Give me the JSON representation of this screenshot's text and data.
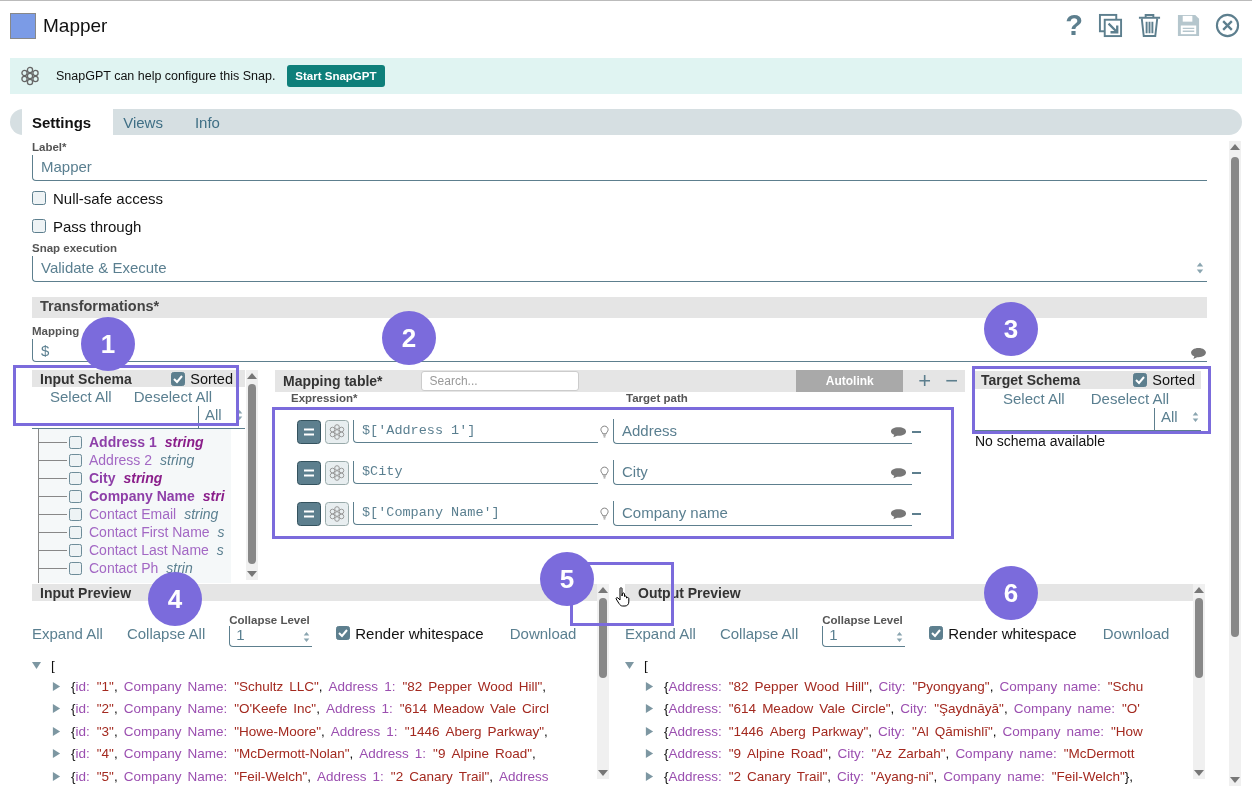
{
  "window": {
    "title": "Mapper"
  },
  "toolbar": [
    {
      "kind": "help",
      "glyph": "?",
      "disabled": false
    },
    {
      "kind": "export",
      "disabled": false
    },
    {
      "kind": "delete",
      "disabled": false
    },
    {
      "kind": "save",
      "disabled": true
    },
    {
      "kind": "close",
      "disabled": false
    }
  ],
  "banner": {
    "text": "SnapGPT can help configure this Snap.",
    "button": "Start SnapGPT"
  },
  "tabs": [
    {
      "label": "Settings",
      "selected": true
    },
    {
      "label": "Views",
      "selected": false
    },
    {
      "label": "Info",
      "selected": false
    }
  ],
  "label_field": {
    "label": "Label*",
    "value": "Mapper"
  },
  "options": [
    {
      "label": "Null-safe access",
      "checked": false
    },
    {
      "label": "Pass through",
      "checked": false
    }
  ],
  "snap_execution": {
    "label": "Snap execution",
    "value": "Validate & Execute"
  },
  "transformations": {
    "title": "Transformations*",
    "mapping_root": {
      "label": "Mapping",
      "value": "$"
    }
  },
  "input_schema": {
    "title": "Input Schema",
    "sorted": {
      "label": "Sorted",
      "checked": true
    },
    "select_all": "Select All",
    "deselect_all": "Deselect All",
    "filter": "All",
    "items": [
      {
        "name": "Address 1",
        "type": "string",
        "mapped": true,
        "checked": false
      },
      {
        "name": "Address 2",
        "type": "string",
        "mapped": false,
        "checked": false
      },
      {
        "name": "City",
        "type": "string",
        "mapped": true,
        "checked": false
      },
      {
        "name": "Company Name",
        "type": "stri",
        "mapped": true,
        "checked": false
      },
      {
        "name": "Contact Email",
        "type": "string",
        "mapped": false,
        "checked": false
      },
      {
        "name": "Contact First Name",
        "type": "s",
        "mapped": false,
        "checked": false
      },
      {
        "name": "Contact Last Name",
        "type": "s",
        "mapped": false,
        "checked": false
      },
      {
        "name": "Contact Ph",
        "type": "strin",
        "mapped": false,
        "checked": false
      }
    ]
  },
  "mapping_table": {
    "title": "Mapping table*",
    "search": {
      "placeholder": "Search..."
    },
    "autolink": "Autolink",
    "add": "+",
    "remove": "−",
    "columns": [
      "Expression*",
      "Target path"
    ],
    "rows": [
      {
        "expression": "$['Address 1']",
        "target": "Address"
      },
      {
        "expression": "$City",
        "target": "City"
      },
      {
        "expression": "$['Company Name']",
        "target": "Company name"
      }
    ]
  },
  "target_schema": {
    "title": "Target Schema",
    "sorted": {
      "label": "Sorted",
      "checked": true
    },
    "select_all": "Select All",
    "deselect_all": "Deselect All",
    "filter": "All",
    "empty": "No schema available"
  },
  "previews": [
    {
      "title": "Input Preview",
      "expand_all": "Expand All",
      "collapse_all": "Collapse All",
      "collapse_level": {
        "label": "Collapse Level",
        "value": "1"
      },
      "render_whitespace": {
        "label": "Render whitespace",
        "checked": true
      },
      "download": "Download",
      "root": "[",
      "rows": [
        {
          "tokens": [
            {
              "kind": "open",
              "text": "{"
            },
            {
              "kind": "key",
              "text": "id:"
            },
            {
              "kind": "value",
              "text": "\"1\""
            },
            {
              "kind": "sep",
              "text": ","
            },
            {
              "kind": "key",
              "text": "Company Name:"
            },
            {
              "kind": "value",
              "text": "\"Schultz LLC\""
            },
            {
              "kind": "sep",
              "text": ","
            },
            {
              "kind": "key",
              "text": "Address 1:"
            },
            {
              "kind": "value",
              "text": "\"82 Pepper Wood Hill\""
            },
            {
              "kind": "sep",
              "text": ","
            }
          ]
        },
        {
          "tokens": [
            {
              "kind": "open",
              "text": "{"
            },
            {
              "kind": "key",
              "text": "id:"
            },
            {
              "kind": "value",
              "text": "\"2\""
            },
            {
              "kind": "sep",
              "text": ","
            },
            {
              "kind": "key",
              "text": "Company Name:"
            },
            {
              "kind": "value",
              "text": "\"O'Keefe Inc\""
            },
            {
              "kind": "sep",
              "text": ","
            },
            {
              "kind": "key",
              "text": "Address 1:"
            },
            {
              "kind": "value",
              "text": "\"614 Meadow Vale Circl"
            }
          ]
        },
        {
          "tokens": [
            {
              "kind": "open",
              "text": "{"
            },
            {
              "kind": "key",
              "text": "id:"
            },
            {
              "kind": "value",
              "text": "\"3\""
            },
            {
              "kind": "sep",
              "text": ","
            },
            {
              "kind": "key",
              "text": "Company Name:"
            },
            {
              "kind": "value",
              "text": "\"Howe-Moore\""
            },
            {
              "kind": "sep",
              "text": ","
            },
            {
              "kind": "key",
              "text": "Address 1:"
            },
            {
              "kind": "value",
              "text": "\"1446 Aberg Parkway\""
            },
            {
              "kind": "sep",
              "text": ","
            }
          ]
        },
        {
          "tokens": [
            {
              "kind": "open",
              "text": "{"
            },
            {
              "kind": "key",
              "text": "id:"
            },
            {
              "kind": "value",
              "text": "\"4\""
            },
            {
              "kind": "sep",
              "text": ","
            },
            {
              "kind": "key",
              "text": "Company Name:"
            },
            {
              "kind": "value",
              "text": "\"McDermott-Nolan\""
            },
            {
              "kind": "sep",
              "text": ","
            },
            {
              "kind": "key",
              "text": "Address 1:"
            },
            {
              "kind": "value",
              "text": "\"9 Alpine Road\""
            },
            {
              "kind": "sep",
              "text": ","
            }
          ]
        },
        {
          "tokens": [
            {
              "kind": "open",
              "text": "{"
            },
            {
              "kind": "key",
              "text": "id:"
            },
            {
              "kind": "value",
              "text": "\"5\""
            },
            {
              "kind": "sep",
              "text": ","
            },
            {
              "kind": "key",
              "text": "Company Name:"
            },
            {
              "kind": "value",
              "text": "\"Feil-Welch\""
            },
            {
              "kind": "sep",
              "text": ","
            },
            {
              "kind": "key",
              "text": "Address 1:"
            },
            {
              "kind": "value",
              "text": "\"2 Canary Trail\""
            },
            {
              "kind": "sep",
              "text": ","
            },
            {
              "kind": "key",
              "text": "Address"
            }
          ]
        }
      ]
    },
    {
      "title": "Output Preview",
      "expand_all": "Expand All",
      "collapse_all": "Collapse All",
      "collapse_level": {
        "label": "Collapse Level",
        "value": "1"
      },
      "render_whitespace": {
        "label": "Render whitespace",
        "checked": true
      },
      "download": "Download",
      "root": "[",
      "rows": [
        {
          "tokens": [
            {
              "kind": "open",
              "text": "{"
            },
            {
              "kind": "key",
              "text": "Address:"
            },
            {
              "kind": "value",
              "text": "\"82 Pepper Wood Hill\""
            },
            {
              "kind": "sep",
              "text": ","
            },
            {
              "kind": "key",
              "text": "City:"
            },
            {
              "kind": "value",
              "text": "\"Pyongyang\""
            },
            {
              "kind": "sep",
              "text": ","
            },
            {
              "kind": "key",
              "text": "Company name:"
            },
            {
              "kind": "value",
              "text": "\"Schu"
            }
          ]
        },
        {
          "tokens": [
            {
              "kind": "open",
              "text": "{"
            },
            {
              "kind": "key",
              "text": "Address:"
            },
            {
              "kind": "value",
              "text": "\"614 Meadow Vale Circle\""
            },
            {
              "kind": "sep",
              "text": ","
            },
            {
              "kind": "key",
              "text": "City:"
            },
            {
              "kind": "value",
              "text": "\"Şaydnāyā\""
            },
            {
              "kind": "sep",
              "text": ","
            },
            {
              "kind": "key",
              "text": "Company name:"
            },
            {
              "kind": "value",
              "text": "\"O'"
            }
          ]
        },
        {
          "tokens": [
            {
              "kind": "open",
              "text": "{"
            },
            {
              "kind": "key",
              "text": "Address:"
            },
            {
              "kind": "value",
              "text": "\"1446 Aberg Parkway\""
            },
            {
              "kind": "sep",
              "text": ","
            },
            {
              "kind": "key",
              "text": "City:"
            },
            {
              "kind": "value",
              "text": "\"Al Qāmishlī\""
            },
            {
              "kind": "sep",
              "text": ","
            },
            {
              "kind": "key",
              "text": "Company name:"
            },
            {
              "kind": "value",
              "text": "\"How"
            }
          ]
        },
        {
          "tokens": [
            {
              "kind": "open",
              "text": "{"
            },
            {
              "kind": "key",
              "text": "Address:"
            },
            {
              "kind": "value",
              "text": "\"9 Alpine Road\""
            },
            {
              "kind": "sep",
              "text": ","
            },
            {
              "kind": "key",
              "text": "City:"
            },
            {
              "kind": "value",
              "text": "\"Az Zarbah\""
            },
            {
              "kind": "sep",
              "text": ","
            },
            {
              "kind": "key",
              "text": "Company name:"
            },
            {
              "kind": "value",
              "text": "\"McDermott"
            }
          ]
        },
        {
          "tokens": [
            {
              "kind": "open",
              "text": "{"
            },
            {
              "kind": "key",
              "text": "Address:"
            },
            {
              "kind": "value",
              "text": "\"2 Canary Trail\""
            },
            {
              "kind": "sep",
              "text": ","
            },
            {
              "kind": "key",
              "text": "City:"
            },
            {
              "kind": "value",
              "text": "\"Ayang-ni\""
            },
            {
              "kind": "sep",
              "text": ","
            },
            {
              "kind": "key",
              "text": "Company name:"
            },
            {
              "kind": "value",
              "text": "\"Feil-Welch\""
            },
            {
              "kind": "close",
              "text": "},"
            }
          ]
        }
      ]
    }
  ],
  "annotations": [
    {
      "number": "1"
    },
    {
      "number": "2"
    },
    {
      "number": "3"
    },
    {
      "number": "4"
    },
    {
      "number": "5"
    },
    {
      "number": "6"
    }
  ]
}
